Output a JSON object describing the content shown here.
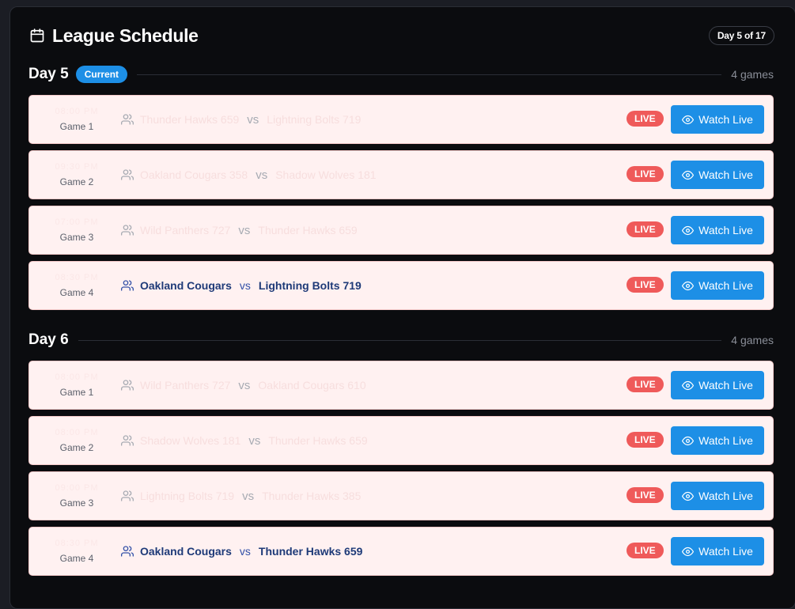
{
  "header": {
    "title": "League Schedule",
    "day_chip": "Day 5 of 17"
  },
  "days": [
    {
      "label": "Day 5",
      "badge": "Current",
      "games_count": "4 games",
      "games": [
        {
          "time": "08:00 PM",
          "number": "Game 1",
          "home": "Thunder Hawks 659",
          "vs": "vs",
          "away": "Lightning Bolts 719",
          "status": "LIVE",
          "action": "Watch Live",
          "faded": true
        },
        {
          "time": "09:30 PM",
          "number": "Game 2",
          "home": "Oakland Cougars 358",
          "vs": "vs",
          "away": "Shadow Wolves 181",
          "status": "LIVE",
          "action": "Watch Live",
          "faded": true
        },
        {
          "time": "07:00 PM",
          "number": "Game 3",
          "home": "Wild Panthers 727",
          "vs": "vs",
          "away": "Thunder Hawks 659",
          "status": "LIVE",
          "action": "Watch Live",
          "faded": true
        },
        {
          "time": "08:30 PM",
          "number": "Game 4",
          "home": "Oakland Cougars",
          "vs": "vs",
          "away": "Lightning Bolts 719",
          "status": "LIVE",
          "action": "Watch Live",
          "faded": false
        }
      ]
    },
    {
      "label": "Day 6",
      "badge": "",
      "games_count": "4 games",
      "games": [
        {
          "time": "08:00 PM",
          "number": "Game 1",
          "home": "Wild Panthers 727",
          "vs": "vs",
          "away": "Oakland Cougars 610",
          "status": "LIVE",
          "action": "Watch Live",
          "faded": true
        },
        {
          "time": "08:00 PM",
          "number": "Game 2",
          "home": "Shadow Wolves 181",
          "vs": "vs",
          "away": "Thunder Hawks 659",
          "status": "LIVE",
          "action": "Watch Live",
          "faded": true
        },
        {
          "time": "09:00 PM",
          "number": "Game 3",
          "home": "Lightning Bolts 719",
          "vs": "vs",
          "away": "Thunder Hawks 385",
          "status": "LIVE",
          "action": "Watch Live",
          "faded": true
        },
        {
          "time": "08:30 PM",
          "number": "Game 4",
          "home": "Oakland Cougars",
          "vs": "vs",
          "away": "Thunder Hawks 659",
          "status": "LIVE",
          "action": "Watch Live",
          "faded": false
        }
      ]
    }
  ]
}
